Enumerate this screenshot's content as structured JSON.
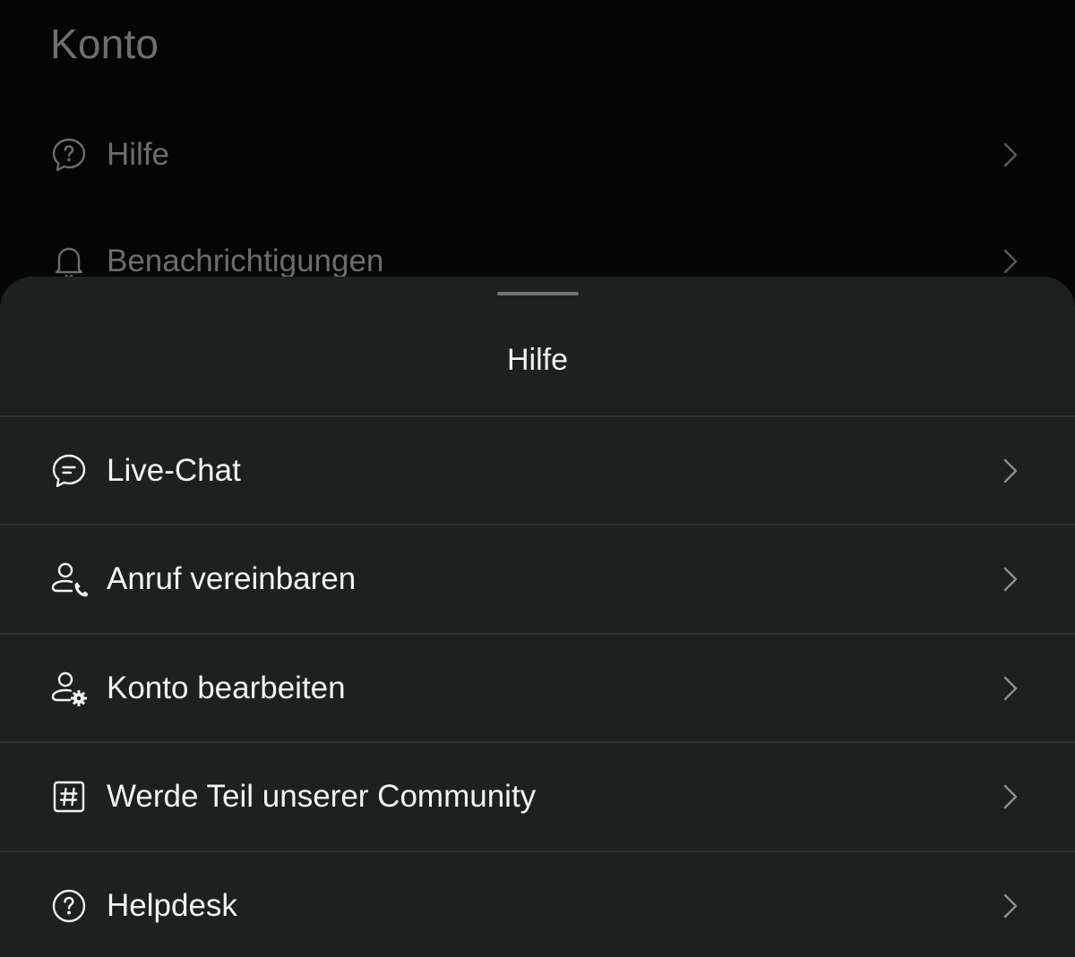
{
  "background_page": {
    "title": "Konto",
    "items": [
      {
        "label": "Hilfe",
        "icon": "help-chat-icon"
      },
      {
        "label": "Benachrichtigungen",
        "icon": "bell-icon"
      }
    ]
  },
  "sheet": {
    "title": "Hilfe",
    "items": [
      {
        "label": "Live-Chat",
        "icon": "chat-bubble-icon"
      },
      {
        "label": "Anruf vereinbaren",
        "icon": "user-phone-icon"
      },
      {
        "label": "Konto bearbeiten",
        "icon": "user-gear-icon"
      },
      {
        "label": "Werde Teil unserer Community",
        "icon": "hashtag-icon"
      },
      {
        "label": "Helpdesk",
        "icon": "question-circle-icon"
      }
    ]
  },
  "colors": {
    "sheet_background": "#1c211f",
    "text_primary": "#f2f4f3",
    "text_dimmed": "#6d6d6d",
    "divider": "#2c3431"
  }
}
